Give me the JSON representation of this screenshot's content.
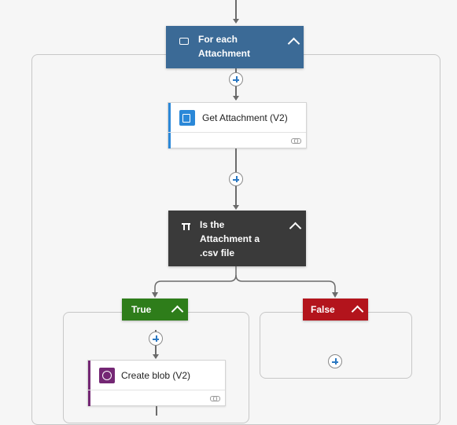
{
  "for_each": {
    "title_line1": "For each",
    "title_line2": "Attachment",
    "color": "#3b6a96"
  },
  "get_attachment": {
    "title": "Get Attachment (V2)",
    "accent": "#2b88d8"
  },
  "condition": {
    "title_line1": "Is the",
    "title_line2": "Attachment a",
    "title_line3": ".csv file",
    "color": "#3a3a3a"
  },
  "true_branch": {
    "label": "True",
    "color": "#2e7d1a"
  },
  "false_branch": {
    "label": "False",
    "color": "#b3141c"
  },
  "create_blob": {
    "title": "Create blob (V2)",
    "accent": "#742774"
  },
  "icons": [
    "loop-icon",
    "outlook-icon",
    "condition-icon",
    "blob-icon",
    "link-icon",
    "plus-icon",
    "chevron-up-icon"
  ]
}
